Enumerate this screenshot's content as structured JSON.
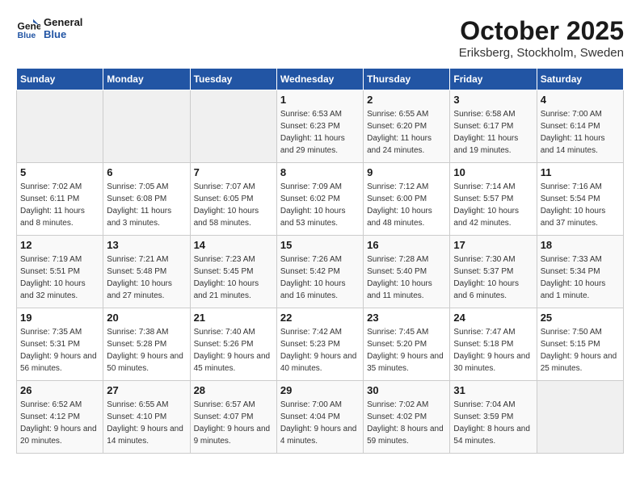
{
  "logo": {
    "line1": "General",
    "line2": "Blue"
  },
  "title": "October 2025",
  "location": "Eriksberg, Stockholm, Sweden",
  "weekdays": [
    "Sunday",
    "Monday",
    "Tuesday",
    "Wednesday",
    "Thursday",
    "Friday",
    "Saturday"
  ],
  "weeks": [
    [
      {
        "day": "",
        "sunrise": "",
        "sunset": "",
        "daylight": ""
      },
      {
        "day": "",
        "sunrise": "",
        "sunset": "",
        "daylight": ""
      },
      {
        "day": "",
        "sunrise": "",
        "sunset": "",
        "daylight": ""
      },
      {
        "day": "1",
        "sunrise": "Sunrise: 6:53 AM",
        "sunset": "Sunset: 6:23 PM",
        "daylight": "Daylight: 11 hours and 29 minutes."
      },
      {
        "day": "2",
        "sunrise": "Sunrise: 6:55 AM",
        "sunset": "Sunset: 6:20 PM",
        "daylight": "Daylight: 11 hours and 24 minutes."
      },
      {
        "day": "3",
        "sunrise": "Sunrise: 6:58 AM",
        "sunset": "Sunset: 6:17 PM",
        "daylight": "Daylight: 11 hours and 19 minutes."
      },
      {
        "day": "4",
        "sunrise": "Sunrise: 7:00 AM",
        "sunset": "Sunset: 6:14 PM",
        "daylight": "Daylight: 11 hours and 14 minutes."
      }
    ],
    [
      {
        "day": "5",
        "sunrise": "Sunrise: 7:02 AM",
        "sunset": "Sunset: 6:11 PM",
        "daylight": "Daylight: 11 hours and 8 minutes."
      },
      {
        "day": "6",
        "sunrise": "Sunrise: 7:05 AM",
        "sunset": "Sunset: 6:08 PM",
        "daylight": "Daylight: 11 hours and 3 minutes."
      },
      {
        "day": "7",
        "sunrise": "Sunrise: 7:07 AM",
        "sunset": "Sunset: 6:05 PM",
        "daylight": "Daylight: 10 hours and 58 minutes."
      },
      {
        "day": "8",
        "sunrise": "Sunrise: 7:09 AM",
        "sunset": "Sunset: 6:02 PM",
        "daylight": "Daylight: 10 hours and 53 minutes."
      },
      {
        "day": "9",
        "sunrise": "Sunrise: 7:12 AM",
        "sunset": "Sunset: 6:00 PM",
        "daylight": "Daylight: 10 hours and 48 minutes."
      },
      {
        "day": "10",
        "sunrise": "Sunrise: 7:14 AM",
        "sunset": "Sunset: 5:57 PM",
        "daylight": "Daylight: 10 hours and 42 minutes."
      },
      {
        "day": "11",
        "sunrise": "Sunrise: 7:16 AM",
        "sunset": "Sunset: 5:54 PM",
        "daylight": "Daylight: 10 hours and 37 minutes."
      }
    ],
    [
      {
        "day": "12",
        "sunrise": "Sunrise: 7:19 AM",
        "sunset": "Sunset: 5:51 PM",
        "daylight": "Daylight: 10 hours and 32 minutes."
      },
      {
        "day": "13",
        "sunrise": "Sunrise: 7:21 AM",
        "sunset": "Sunset: 5:48 PM",
        "daylight": "Daylight: 10 hours and 27 minutes."
      },
      {
        "day": "14",
        "sunrise": "Sunrise: 7:23 AM",
        "sunset": "Sunset: 5:45 PM",
        "daylight": "Daylight: 10 hours and 21 minutes."
      },
      {
        "day": "15",
        "sunrise": "Sunrise: 7:26 AM",
        "sunset": "Sunset: 5:42 PM",
        "daylight": "Daylight: 10 hours and 16 minutes."
      },
      {
        "day": "16",
        "sunrise": "Sunrise: 7:28 AM",
        "sunset": "Sunset: 5:40 PM",
        "daylight": "Daylight: 10 hours and 11 minutes."
      },
      {
        "day": "17",
        "sunrise": "Sunrise: 7:30 AM",
        "sunset": "Sunset: 5:37 PM",
        "daylight": "Daylight: 10 hours and 6 minutes."
      },
      {
        "day": "18",
        "sunrise": "Sunrise: 7:33 AM",
        "sunset": "Sunset: 5:34 PM",
        "daylight": "Daylight: 10 hours and 1 minute."
      }
    ],
    [
      {
        "day": "19",
        "sunrise": "Sunrise: 7:35 AM",
        "sunset": "Sunset: 5:31 PM",
        "daylight": "Daylight: 9 hours and 56 minutes."
      },
      {
        "day": "20",
        "sunrise": "Sunrise: 7:38 AM",
        "sunset": "Sunset: 5:28 PM",
        "daylight": "Daylight: 9 hours and 50 minutes."
      },
      {
        "day": "21",
        "sunrise": "Sunrise: 7:40 AM",
        "sunset": "Sunset: 5:26 PM",
        "daylight": "Daylight: 9 hours and 45 minutes."
      },
      {
        "day": "22",
        "sunrise": "Sunrise: 7:42 AM",
        "sunset": "Sunset: 5:23 PM",
        "daylight": "Daylight: 9 hours and 40 minutes."
      },
      {
        "day": "23",
        "sunrise": "Sunrise: 7:45 AM",
        "sunset": "Sunset: 5:20 PM",
        "daylight": "Daylight: 9 hours and 35 minutes."
      },
      {
        "day": "24",
        "sunrise": "Sunrise: 7:47 AM",
        "sunset": "Sunset: 5:18 PM",
        "daylight": "Daylight: 9 hours and 30 minutes."
      },
      {
        "day": "25",
        "sunrise": "Sunrise: 7:50 AM",
        "sunset": "Sunset: 5:15 PM",
        "daylight": "Daylight: 9 hours and 25 minutes."
      }
    ],
    [
      {
        "day": "26",
        "sunrise": "Sunrise: 6:52 AM",
        "sunset": "Sunset: 4:12 PM",
        "daylight": "Daylight: 9 hours and 20 minutes."
      },
      {
        "day": "27",
        "sunrise": "Sunrise: 6:55 AM",
        "sunset": "Sunset: 4:10 PM",
        "daylight": "Daylight: 9 hours and 14 minutes."
      },
      {
        "day": "28",
        "sunrise": "Sunrise: 6:57 AM",
        "sunset": "Sunset: 4:07 PM",
        "daylight": "Daylight: 9 hours and 9 minutes."
      },
      {
        "day": "29",
        "sunrise": "Sunrise: 7:00 AM",
        "sunset": "Sunset: 4:04 PM",
        "daylight": "Daylight: 9 hours and 4 minutes."
      },
      {
        "day": "30",
        "sunrise": "Sunrise: 7:02 AM",
        "sunset": "Sunset: 4:02 PM",
        "daylight": "Daylight: 8 hours and 59 minutes."
      },
      {
        "day": "31",
        "sunrise": "Sunrise: 7:04 AM",
        "sunset": "Sunset: 3:59 PM",
        "daylight": "Daylight: 8 hours and 54 minutes."
      },
      {
        "day": "",
        "sunrise": "",
        "sunset": "",
        "daylight": ""
      }
    ]
  ]
}
